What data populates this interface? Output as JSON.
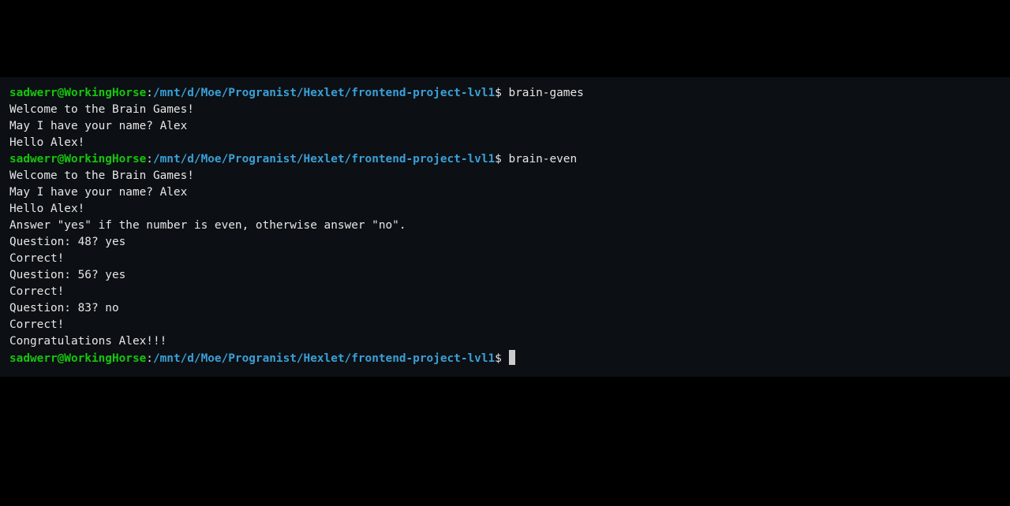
{
  "colors": {
    "background": "#000000",
    "terminal_background": "#0c1014",
    "prompt_user": "#16c60c",
    "prompt_path": "#3b9fd6",
    "text": "#e6e6e6"
  },
  "prompt": {
    "user_host": "sadwerr@WorkingHorse",
    "separator": ":",
    "path": "/mnt/d/Moe/Progranist/Hexlet/frontend-project-lvl1",
    "symbol": "$ "
  },
  "session": [
    {
      "type": "command",
      "text": "brain-games"
    },
    {
      "type": "output",
      "text": "Welcome to the Brain Games!"
    },
    {
      "type": "output",
      "text": "May I have your name? Alex"
    },
    {
      "type": "output",
      "text": "Hello Alex!"
    },
    {
      "type": "command",
      "text": "brain-even"
    },
    {
      "type": "output",
      "text": "Welcome to the Brain Games!"
    },
    {
      "type": "output",
      "text": "May I have your name? Alex"
    },
    {
      "type": "output",
      "text": "Hello Alex!"
    },
    {
      "type": "output",
      "text": "Answer \"yes\" if the number is even, otherwise answer \"no\"."
    },
    {
      "type": "output",
      "text": "Question: 48? yes"
    },
    {
      "type": "output",
      "text": "Correct!"
    },
    {
      "type": "output",
      "text": "Question: 56? yes"
    },
    {
      "type": "output",
      "text": "Correct!"
    },
    {
      "type": "output",
      "text": "Question: 83? no"
    },
    {
      "type": "output",
      "text": "Correct!"
    },
    {
      "type": "output",
      "text": "Congratulations Alex!!!"
    },
    {
      "type": "command",
      "text": ""
    }
  ]
}
